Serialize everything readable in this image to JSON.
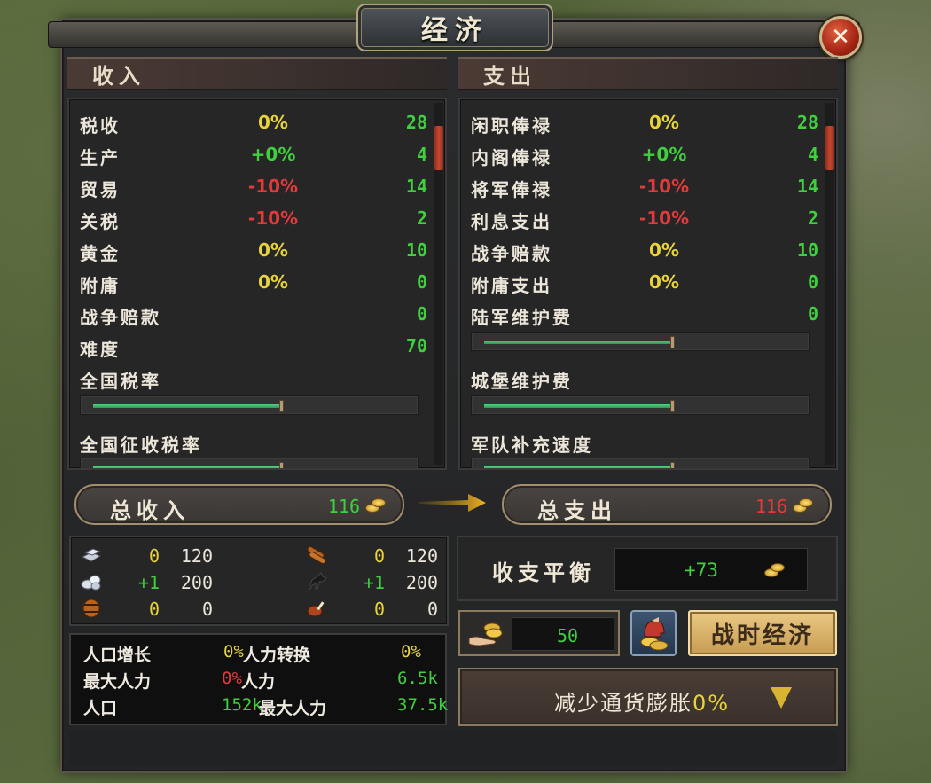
{
  "window": {
    "title": "经济",
    "close_label": "✕"
  },
  "income": {
    "header": "收入",
    "rows": [
      {
        "label": "税收",
        "pct": "0%",
        "pct_color": "yellow",
        "value": "28"
      },
      {
        "label": "生产",
        "pct": "+0%",
        "pct_color": "green",
        "value": "4"
      },
      {
        "label": "贸易",
        "pct": "-10%",
        "pct_color": "red",
        "value": "14"
      },
      {
        "label": "关税",
        "pct": "-10%",
        "pct_color": "red",
        "value": "2"
      },
      {
        "label": "黄金",
        "pct": "0%",
        "pct_color": "yellow",
        "value": "10"
      },
      {
        "label": "附庸",
        "pct": "0%",
        "pct_color": "yellow",
        "value": "0"
      },
      {
        "label": "战争赔款",
        "pct": "",
        "pct_color": "yellow",
        "value": "0"
      },
      {
        "label": "难度",
        "pct": "",
        "pct_color": "yellow",
        "value": "70"
      }
    ],
    "slider1_label": "全国税率",
    "slider1_level": 0.6,
    "slider2_label": "全国征收税率",
    "slider2_level": 0.6
  },
  "expense": {
    "header": "支出",
    "rows": [
      {
        "label": "闲职俸禄",
        "pct": "0%",
        "pct_color": "yellow",
        "value": "28"
      },
      {
        "label": "内阁俸禄",
        "pct": "+0%",
        "pct_color": "green",
        "value": "4"
      },
      {
        "label": "将军俸禄",
        "pct": "-10%",
        "pct_color": "red",
        "value": "14"
      },
      {
        "label": "利息支出",
        "pct": "-10%",
        "pct_color": "red",
        "value": "2"
      },
      {
        "label": "战争赔款",
        "pct": "0%",
        "pct_color": "yellow",
        "value": "10"
      },
      {
        "label": "附庸支出",
        "pct": "0%",
        "pct_color": "yellow",
        "value": "0"
      },
      {
        "label": "陆军维护费",
        "pct": "",
        "pct_color": "yellow",
        "value": "0"
      }
    ],
    "slider1_level": 0.6,
    "slider2_label": "城堡维护费",
    "slider2_level": 0.6,
    "slider3_label": "军队补充速度",
    "slider3_level": 0.6
  },
  "totals": {
    "income_label": "总收入",
    "income_value": "116",
    "expense_label": "总支出",
    "expense_value": "116"
  },
  "resources": [
    {
      "icon": "iron-ingot-icon",
      "delta": "0",
      "delta_color": "yellow",
      "cap": "120"
    },
    {
      "icon": "wood-logs-icon",
      "delta": "0",
      "delta_color": "yellow",
      "cap": "120"
    },
    {
      "icon": "stone-icon",
      "delta": "+1",
      "delta_color": "green",
      "cap": "200"
    },
    {
      "icon": "horse-icon",
      "delta": "+1",
      "delta_color": "green",
      "cap": "200"
    },
    {
      "icon": "barrel-icon",
      "delta": "0",
      "delta_color": "yellow",
      "cap": "0"
    },
    {
      "icon": "meat-icon",
      "delta": "0",
      "delta_color": "yellow",
      "cap": "0"
    }
  ],
  "population": {
    "growth_label": "人口增长",
    "growth_value": "0%",
    "conversion_label": "人力转换",
    "conversion_value": "0%",
    "max_manpower_label": "最大人力",
    "max_manpower_value": "0%",
    "manpower_label": "人力",
    "manpower_value": "6.5k",
    "population_label": "人口",
    "population_value": "152k",
    "max_manpower2_label": "最大人力",
    "max_manpower2_value": "37.5k"
  },
  "balance": {
    "label": "收支平衡",
    "value": "+73"
  },
  "recruit": {
    "value": "50"
  },
  "war_economy_label": "战时经济",
  "inflation": {
    "label": "减少通货膨胀",
    "value": "0%"
  },
  "colors": {
    "green": "#3fcf3f",
    "yellow": "#e8d43a",
    "red": "#e23a3a",
    "gold_trim": "#a38f6d"
  }
}
